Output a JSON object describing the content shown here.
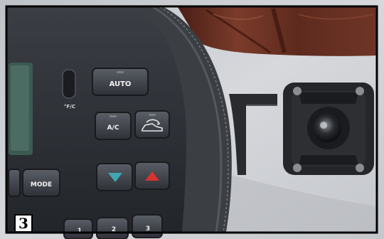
{
  "figure_number": "3",
  "controls": {
    "auto_label": "AUTO",
    "temp_unit_label": "°F/C",
    "ac_label": "A/C",
    "mode_label": "MODE",
    "preset_1": "1",
    "preset_2": "2",
    "preset_3": "3"
  },
  "icons": {
    "recirculation": "car-recirculation-icon",
    "temp_down": "triangle-down-icon",
    "temp_up": "triangle-up-icon"
  },
  "colors": {
    "frame_border": "#000000",
    "dashboard_panel": "#2b2e33",
    "leather_trim": "#3a3d42",
    "wood_trim": "#6b2f22",
    "dash_surface": "#cfd2d6",
    "down_arrow": "#3fa7b0",
    "up_arrow": "#d8322f"
  }
}
